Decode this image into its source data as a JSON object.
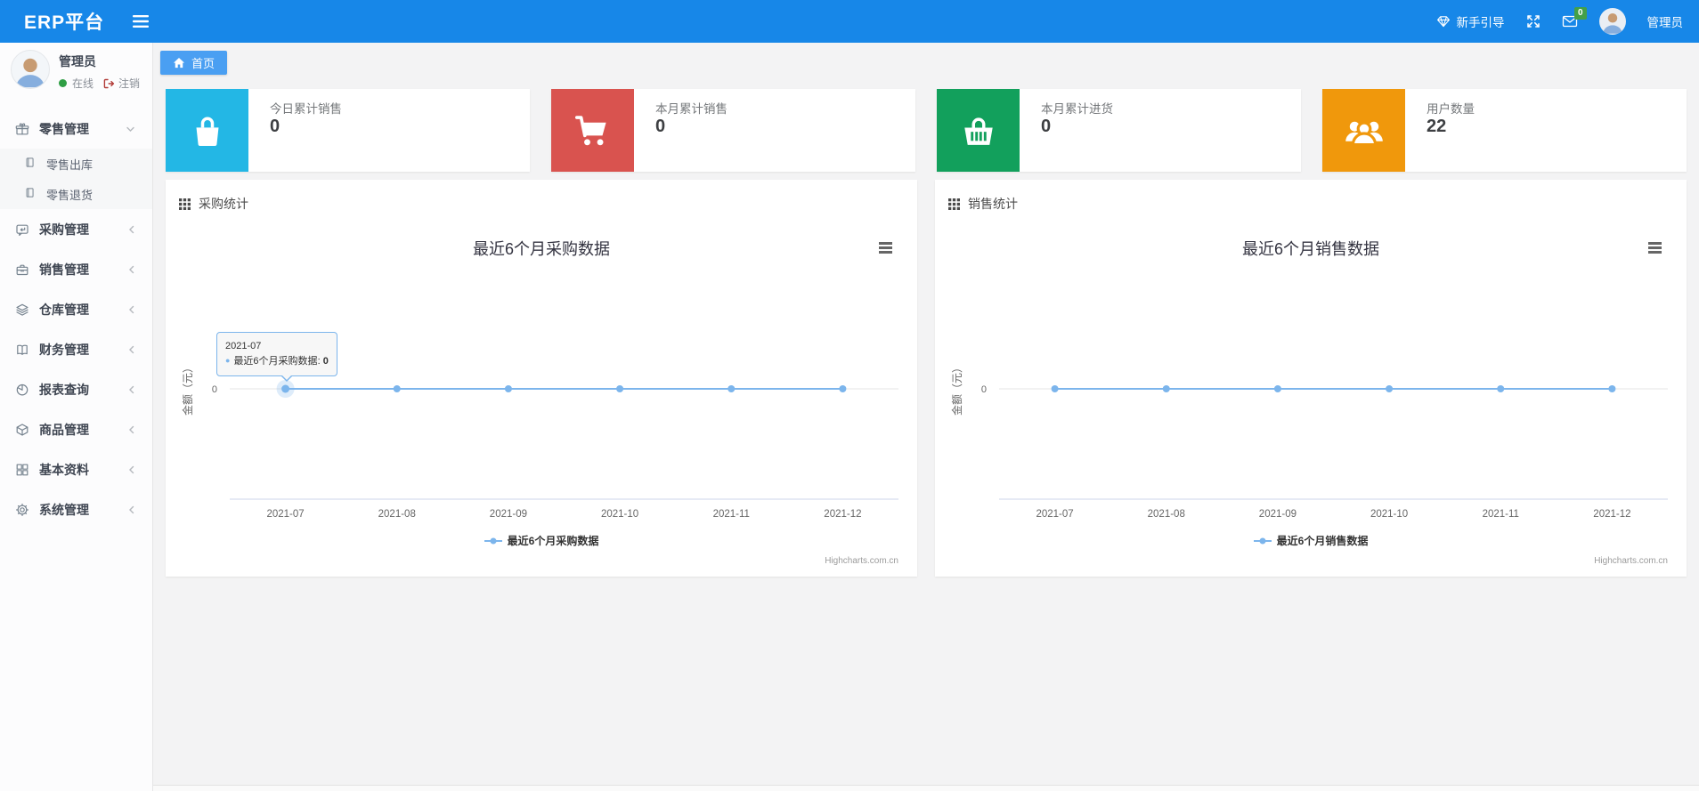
{
  "navbar": {
    "brand": "ERP平台",
    "guide_label": "新手引导",
    "messages_badge": "0",
    "username": "管理员"
  },
  "sidebar": {
    "user": {
      "name": "管理员",
      "status_online": "在线",
      "logout_label": "注销"
    },
    "menu": [
      {
        "key": "retail",
        "label": "零售管理",
        "icon": "gift-icon",
        "state": "expanded",
        "children": [
          {
            "key": "retail-outbound",
            "label": "零售出库",
            "icon": "book-icon"
          },
          {
            "key": "retail-returns",
            "label": "零售退货",
            "icon": "book-icon"
          }
        ]
      },
      {
        "key": "purchase",
        "label": "采购管理",
        "icon": "comment-icon",
        "state": "collapsed"
      },
      {
        "key": "sales",
        "label": "销售管理",
        "icon": "briefcase-icon",
        "state": "collapsed"
      },
      {
        "key": "warehouse",
        "label": "仓库管理",
        "icon": "layers-icon",
        "state": "collapsed"
      },
      {
        "key": "finance",
        "label": "财务管理",
        "icon": "open-book-icon",
        "state": "collapsed"
      },
      {
        "key": "reports",
        "label": "报表查询",
        "icon": "pie-chart-icon",
        "state": "collapsed"
      },
      {
        "key": "goods",
        "label": "商品管理",
        "icon": "package-icon",
        "state": "collapsed"
      },
      {
        "key": "basic-data",
        "label": "基本资料",
        "icon": "grid-icon",
        "state": "collapsed"
      },
      {
        "key": "system",
        "label": "系统管理",
        "icon": "gear-icon",
        "state": "collapsed"
      }
    ]
  },
  "breadcrumb": {
    "home_label": "首页"
  },
  "stats": {
    "cards": [
      {
        "key": "today-sales",
        "label": "今日累计销售",
        "value": "0",
        "icon": "shopping-bag-icon",
        "color": "#23b7e5"
      },
      {
        "key": "month-sales",
        "label": "本月累计销售",
        "value": "0",
        "icon": "shopping-cart-icon",
        "color": "#d9534f"
      },
      {
        "key": "month-purchase",
        "label": "本月累计进货",
        "value": "0",
        "icon": "basket-icon",
        "color": "#12a05c"
      },
      {
        "key": "user-count",
        "label": "用户数量",
        "value": "22",
        "icon": "users-icon",
        "color": "#f0980c"
      }
    ]
  },
  "chart_data": [
    {
      "type": "line",
      "panel_title": "采购统计",
      "title": "最近6个月采购数据",
      "categories": [
        "2021-07",
        "2021-08",
        "2021-09",
        "2021-10",
        "2021-11",
        "2021-12"
      ],
      "series": [
        {
          "name": "最近6个月采购数据",
          "values": [
            0,
            0,
            0,
            0,
            0,
            0
          ]
        }
      ],
      "ylabel": "金额（元）",
      "yticks": [
        "0"
      ],
      "grid": false,
      "legend_position": "bottom",
      "line_color": "#7cb5ec",
      "credit": "Highcharts.com.cn",
      "tooltip": {
        "visible": true,
        "point_index": 0,
        "header": "2021-07",
        "series_label": "最近6个月采购数据",
        "value": "0"
      }
    },
    {
      "type": "line",
      "panel_title": "销售统计",
      "title": "最近6个月销售数据",
      "categories": [
        "2021-07",
        "2021-08",
        "2021-09",
        "2021-10",
        "2021-11",
        "2021-12"
      ],
      "series": [
        {
          "name": "最近6个月销售数据",
          "values": [
            0,
            0,
            0,
            0,
            0,
            0
          ]
        }
      ],
      "ylabel": "金额（元）",
      "yticks": [
        "0"
      ],
      "grid": false,
      "legend_position": "bottom",
      "line_color": "#7cb5ec",
      "credit": "Highcharts.com.cn",
      "tooltip": {
        "visible": false
      }
    }
  ]
}
